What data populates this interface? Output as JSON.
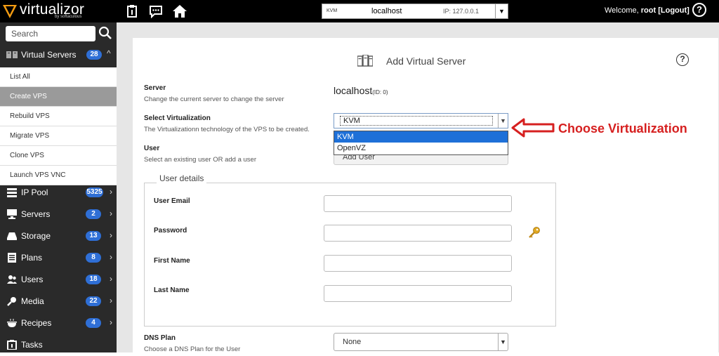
{
  "app": {
    "name": "virtualizor",
    "sub": "by softaculous"
  },
  "topbar": {
    "server": {
      "type_logo": "KVM",
      "host": "localhost",
      "ip": "IP: 127.0.0.1"
    },
    "welcome_prefix": "Welcome,",
    "username": "root",
    "logout_label": "[Logout]",
    "help_symbol": "?"
  },
  "sidebar": {
    "search_placeholder": "Search",
    "virtual_servers": {
      "label": "Virtual Servers",
      "count": "28"
    },
    "submenu": [
      "List All",
      "Create VPS",
      "Rebuild VPS",
      "Migrate VPS",
      "Clone VPS",
      "Launch VPS VNC"
    ],
    "active_submenu": "Create VPS",
    "items": [
      {
        "label": "IP Pool",
        "count": "5325",
        "icon": "ip-pool-icon"
      },
      {
        "label": "Servers",
        "count": "2",
        "icon": "servers-icon"
      },
      {
        "label": "Storage",
        "count": "13",
        "icon": "storage-icon"
      },
      {
        "label": "Plans",
        "count": "8",
        "icon": "plans-icon"
      },
      {
        "label": "Users",
        "count": "18",
        "icon": "users-icon"
      },
      {
        "label": "Media",
        "count": "22",
        "icon": "media-icon"
      },
      {
        "label": "Recipes",
        "count": "4",
        "icon": "recipes-icon"
      },
      {
        "label": "Tasks",
        "count": "",
        "icon": "tasks-icon"
      }
    ]
  },
  "main": {
    "title": "Add Virtual Server",
    "help_symbol": "?",
    "server": {
      "label": "Server",
      "desc": "Change the current server to change the server",
      "value": "localhost",
      "id": "(ID: 0)"
    },
    "virtualization": {
      "label": "Select Virtualization",
      "desc": "The Virtualizationn technology of the VPS to be created.",
      "selected": "KVM",
      "options": [
        "KVM",
        "OpenVZ"
      ]
    },
    "user": {
      "label": "User",
      "desc": "Select an existing user OR add a user",
      "selected": "Add User"
    },
    "user_details": {
      "legend": "User details",
      "email_label": "User Email",
      "password_label": "Password",
      "first_name_label": "First Name",
      "last_name_label": "Last Name"
    },
    "dns_plan": {
      "label": "DNS Plan",
      "desc": "Choose a DNS Plan for the User",
      "selected": "None"
    }
  },
  "annotation": {
    "text": "Choose Virtualization",
    "color": "#d62020"
  },
  "colors": {
    "badge": "#2f6fd6",
    "topbar": "#000000",
    "sidebar": "#2a2a2a",
    "dropdown_selected": "#1e70d8"
  }
}
